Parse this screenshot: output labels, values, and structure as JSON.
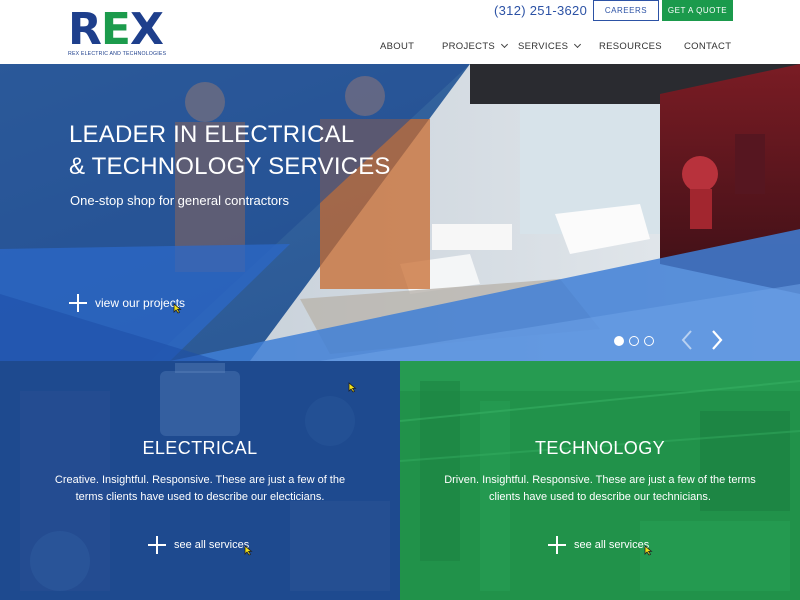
{
  "header": {
    "logo_text": "REX",
    "logo_tagline": "REX ELECTRIC AND TECHNOLOGIES",
    "phone": "(312) 251-3620",
    "careers_label": "CAREERS",
    "quote_label": "GET A QUOTE",
    "nav": [
      {
        "label": "ABOUT",
        "has_dropdown": false
      },
      {
        "label": "PROJECTS",
        "has_dropdown": true
      },
      {
        "label": "SERVICES",
        "has_dropdown": true
      },
      {
        "label": "RESOURCES",
        "has_dropdown": false
      },
      {
        "label": "CONTACT",
        "has_dropdown": false
      }
    ]
  },
  "hero": {
    "title_line1": "LEADER IN ELECTRICAL",
    "title_line2": "& TECHNOLOGY SERVICES",
    "subtitle": "One-stop shop for general contractors",
    "cta_label": "view our projects",
    "slides": 3,
    "active_slide": 1
  },
  "panels": {
    "electrical": {
      "title": "ELECTRICAL",
      "description": "Creative. Insightful. Responsive. These are just a few of the terms clients have used to describe our electicians.",
      "cta_label": "see all services"
    },
    "technology": {
      "title": "TECHNOLOGY",
      "description": "Driven. Insightful. Responsive. These are just a few of the terms clients have used to describe our technicians.",
      "cta_label": "see all services"
    }
  },
  "colors": {
    "brand_blue": "#1e3f8c",
    "brand_green": "#1b9a4c",
    "link_blue": "#2c52a5",
    "cursor_yellow": "#f2e21a"
  }
}
